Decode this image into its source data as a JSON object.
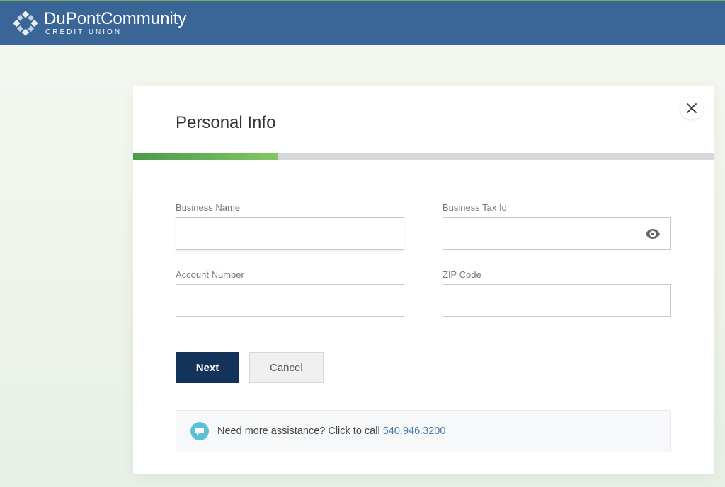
{
  "brand": {
    "name_part1": "DuPont",
    "name_part2": "Community",
    "subtitle": "CREDIT UNION"
  },
  "modal": {
    "title": "Personal Info",
    "progress_percent": 25,
    "fields": {
      "business_name": {
        "label": "Business Name",
        "value": ""
      },
      "business_tax_id": {
        "label": "Business Tax Id",
        "value": ""
      },
      "account_number": {
        "label": "Account Number",
        "value": ""
      },
      "zip_code": {
        "label": "ZIP Code",
        "value": ""
      }
    },
    "buttons": {
      "next": "Next",
      "cancel": "Cancel"
    },
    "assist": {
      "prefix": "Need more assistance? Click to call ",
      "phone": "540.946.3200"
    }
  }
}
